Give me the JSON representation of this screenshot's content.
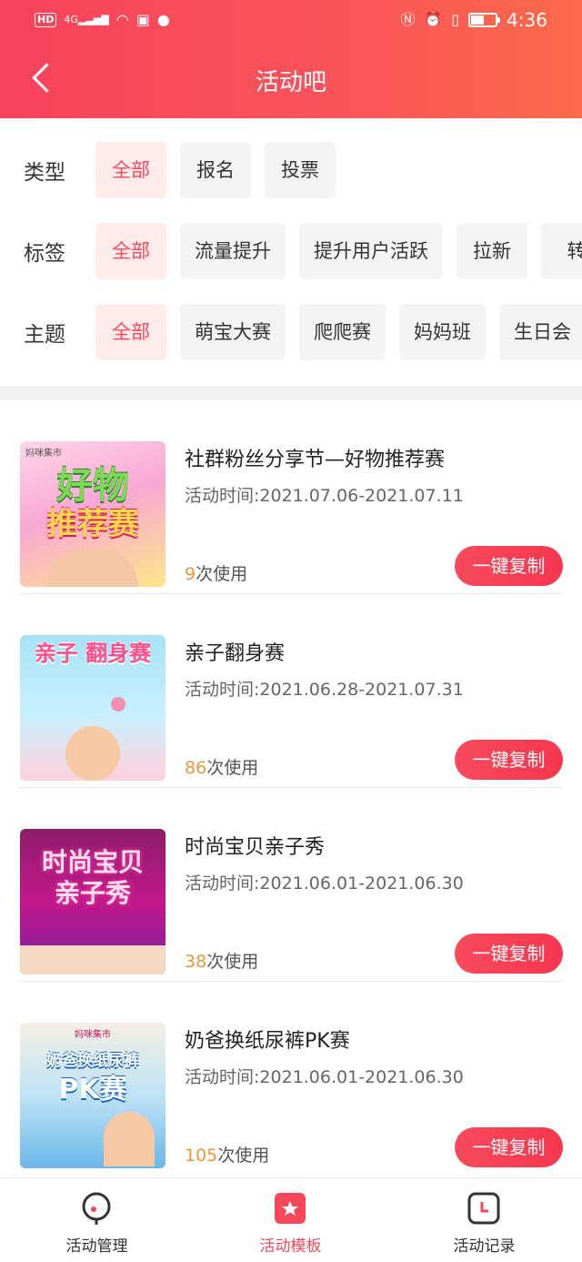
{
  "status_bar": {
    "hd": "HD",
    "network": "4G",
    "time": "4:36"
  },
  "header": {
    "title": "活动吧"
  },
  "filters": [
    {
      "label": "类型",
      "options": [
        "全部",
        "报名",
        "投票"
      ],
      "selected": 0
    },
    {
      "label": "标签",
      "options": [
        "全部",
        "流量提升",
        "提升用户活跃",
        "拉新",
        "转"
      ],
      "selected": 0
    },
    {
      "label": "主题",
      "options": [
        "全部",
        "萌宝大赛",
        "爬爬赛",
        "妈妈班",
        "生日会"
      ],
      "selected": 0
    }
  ],
  "items": [
    {
      "title": "社群粉丝分享节—好物推荐赛",
      "time": "活动时间:2021.07.06-2021.07.11",
      "uses": "9",
      "uses_suffix": "次使用",
      "button": "一键复制",
      "thumb_lines": [
        "好物",
        "推荐赛"
      ],
      "thumb_brand": "妈咪集市"
    },
    {
      "title": "亲子翻身赛",
      "time": "活动时间:2021.06.28-2021.07.31",
      "uses": "86",
      "uses_suffix": "次使用",
      "button": "一键复制",
      "thumb_lines": [
        "亲子 翻身赛"
      ],
      "thumb_brand": ""
    },
    {
      "title": "时尚宝贝亲子秀",
      "time": "活动时间:2021.06.01-2021.06.30",
      "uses": "38",
      "uses_suffix": "次使用",
      "button": "一键复制",
      "thumb_lines": [
        "时尚宝贝",
        "亲子秀"
      ],
      "thumb_brand": ""
    },
    {
      "title": "奶爸换纸尿裤PK赛",
      "time": "活动时间:2021.06.01-2021.06.30",
      "uses": "105",
      "uses_suffix": "次使用",
      "button": "一键复制",
      "thumb_lines": [
        "奶爸换纸尿裤",
        "PK赛"
      ],
      "thumb_brand": "妈咪集市"
    }
  ],
  "bottom_nav": [
    {
      "label": "活动管理",
      "icon": "activity-manage-icon",
      "active": false
    },
    {
      "label": "活动模板",
      "icon": "activity-template-icon",
      "active": true
    },
    {
      "label": "活动记录",
      "icon": "activity-record-icon",
      "active": false
    }
  ],
  "colors": {
    "accent": "#f8475a",
    "header_start": "#f7435c",
    "header_end": "#fb6a4a",
    "count": "#e8963a"
  }
}
